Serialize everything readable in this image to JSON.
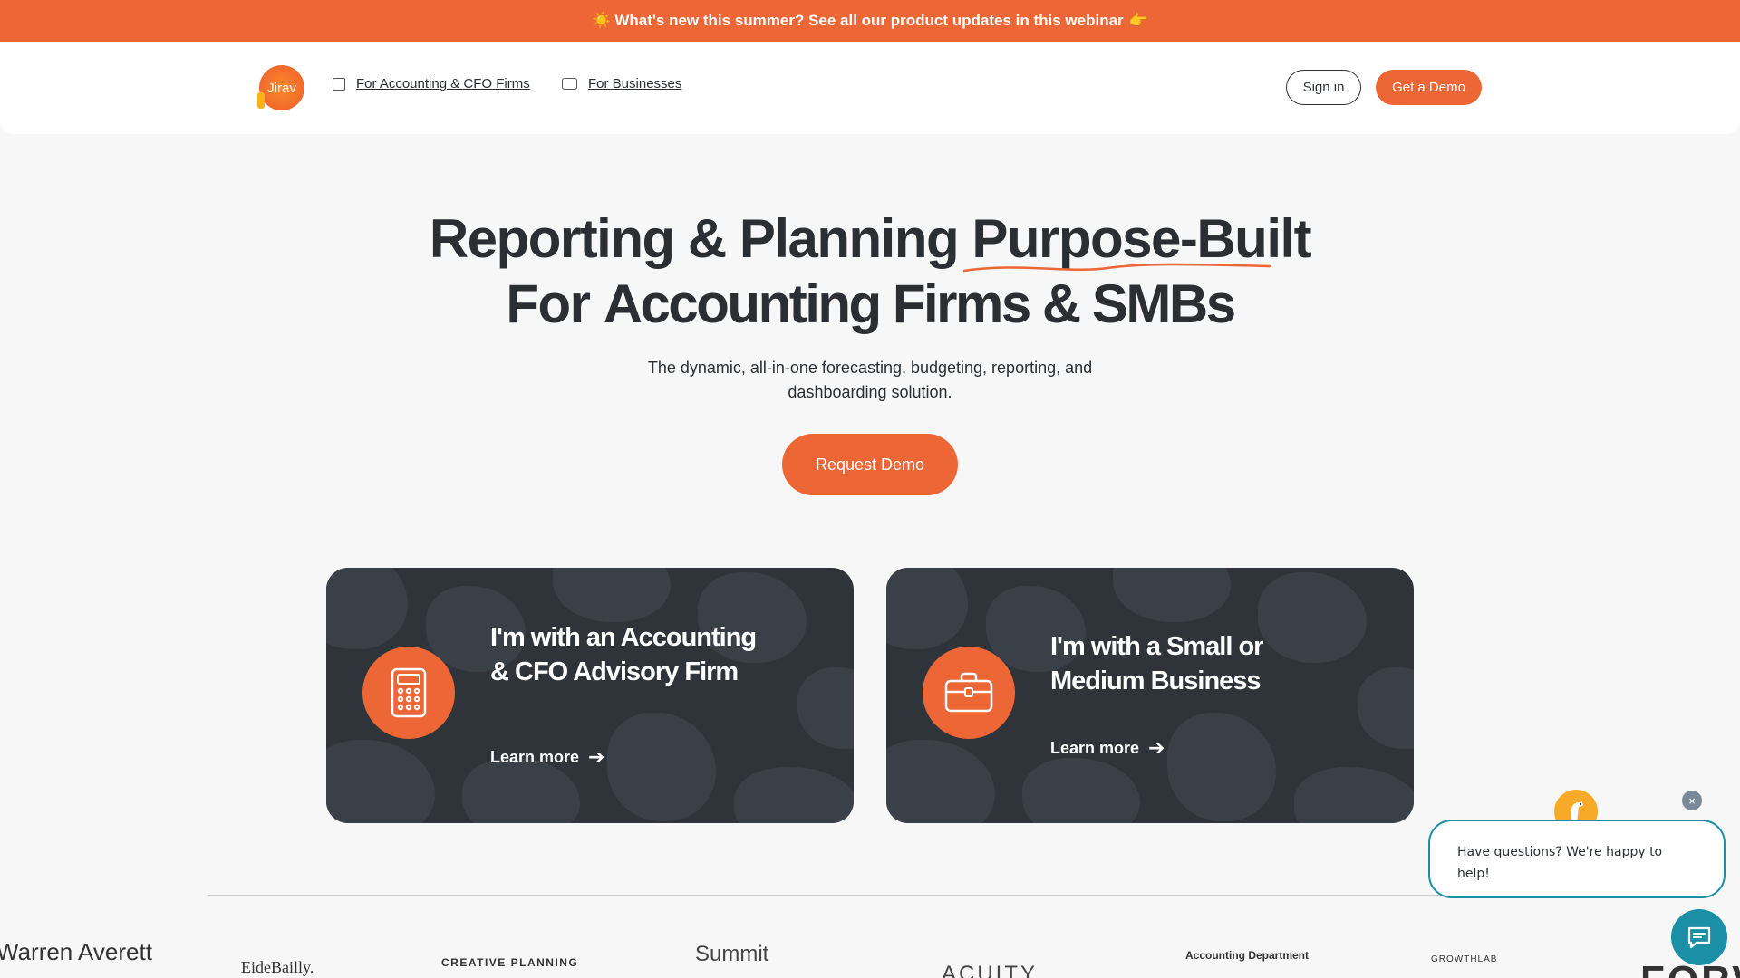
{
  "banner": {
    "sun_icon": "☀️",
    "text": "What's new this summer? See all our product updates in this webinar",
    "hand_icon": "👉"
  },
  "header": {
    "logo_text": "Jirav",
    "nav": [
      {
        "label": "For Accounting & CFO Firms",
        "icon": "building-icon"
      },
      {
        "label": "For Businesses",
        "icon": "briefcase-icon"
      }
    ],
    "sign_in": "Sign in",
    "get_demo": "Get a Demo"
  },
  "hero": {
    "line1": "Reporting & Planning Purpose-Built",
    "line2_prefix": "For ",
    "line2_bold": "Accounting Firms & SMBs",
    "subtitle": "The dynamic, all-in-one forecasting, budgeting, reporting, and dashboarding solution.",
    "cta": "Request Demo"
  },
  "cards": [
    {
      "title": "I'm with an Accounting & CFO Advisory Firm",
      "link": "Learn more",
      "icon": "calculator-icon"
    },
    {
      "title": "I'm with a Small or Medium Business",
      "link": "Learn more",
      "icon": "briefcase-icon"
    }
  ],
  "chat": {
    "message": "Have questions? We're happy to help!",
    "close": "×"
  },
  "logos": {
    "warren": "Warren Averett",
    "eide": "EideBailly.",
    "creative": "CREATIVE PLANNING",
    "summit": "Summit",
    "acuity": "ACUITY",
    "ad": "Accounting Department",
    "growth": "GROWTHLAB",
    "forv": "FORV"
  },
  "colors": {
    "brand_orange": "#ec6636",
    "card_dark": "#2f343a",
    "chat_teal": "#1b8fa6"
  }
}
